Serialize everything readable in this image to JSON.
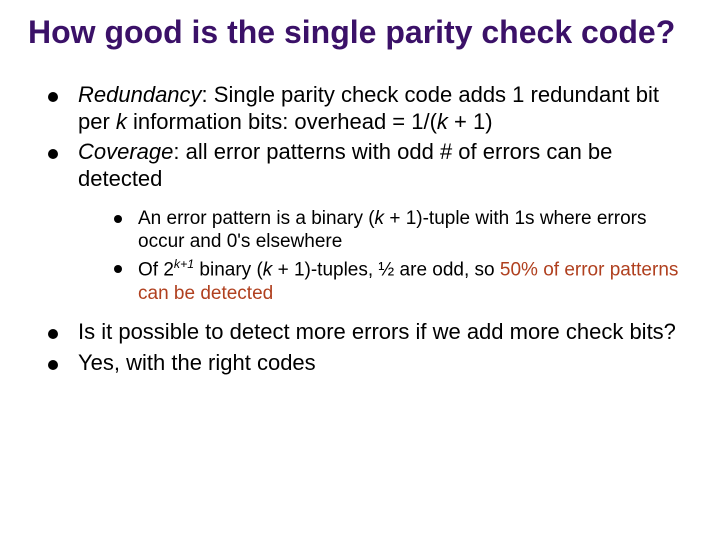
{
  "title": "How good is the single parity check code?",
  "b1": {
    "lead": "Redundancy",
    "tail": ":  Single parity check code adds 1 redundant bit per ",
    "k": "k",
    "after_k": " information bits: overhead = 1/(",
    "k2": "k",
    "close": " + 1)"
  },
  "b2": {
    "lead": "Coverage",
    "tail": ":  all error patterns with odd # of errors can be detected"
  },
  "sub1": {
    "pre": "An error pattern is a binary (",
    "k": "k",
    "post": " + 1)-tuple with 1s where errors occur and 0's elsewhere"
  },
  "sub2": {
    "pre": "Of  2",
    "exp_k": "k",
    "exp_plus1": "+1",
    "mid": " binary (",
    "k": "k",
    "post": " + 1)-tuples, ½ are odd, so ",
    "accent": "50% of error patterns can be detected"
  },
  "b3": "Is it possible to detect more errors if we add more check bits?",
  "b4": "Yes, with the right codes"
}
